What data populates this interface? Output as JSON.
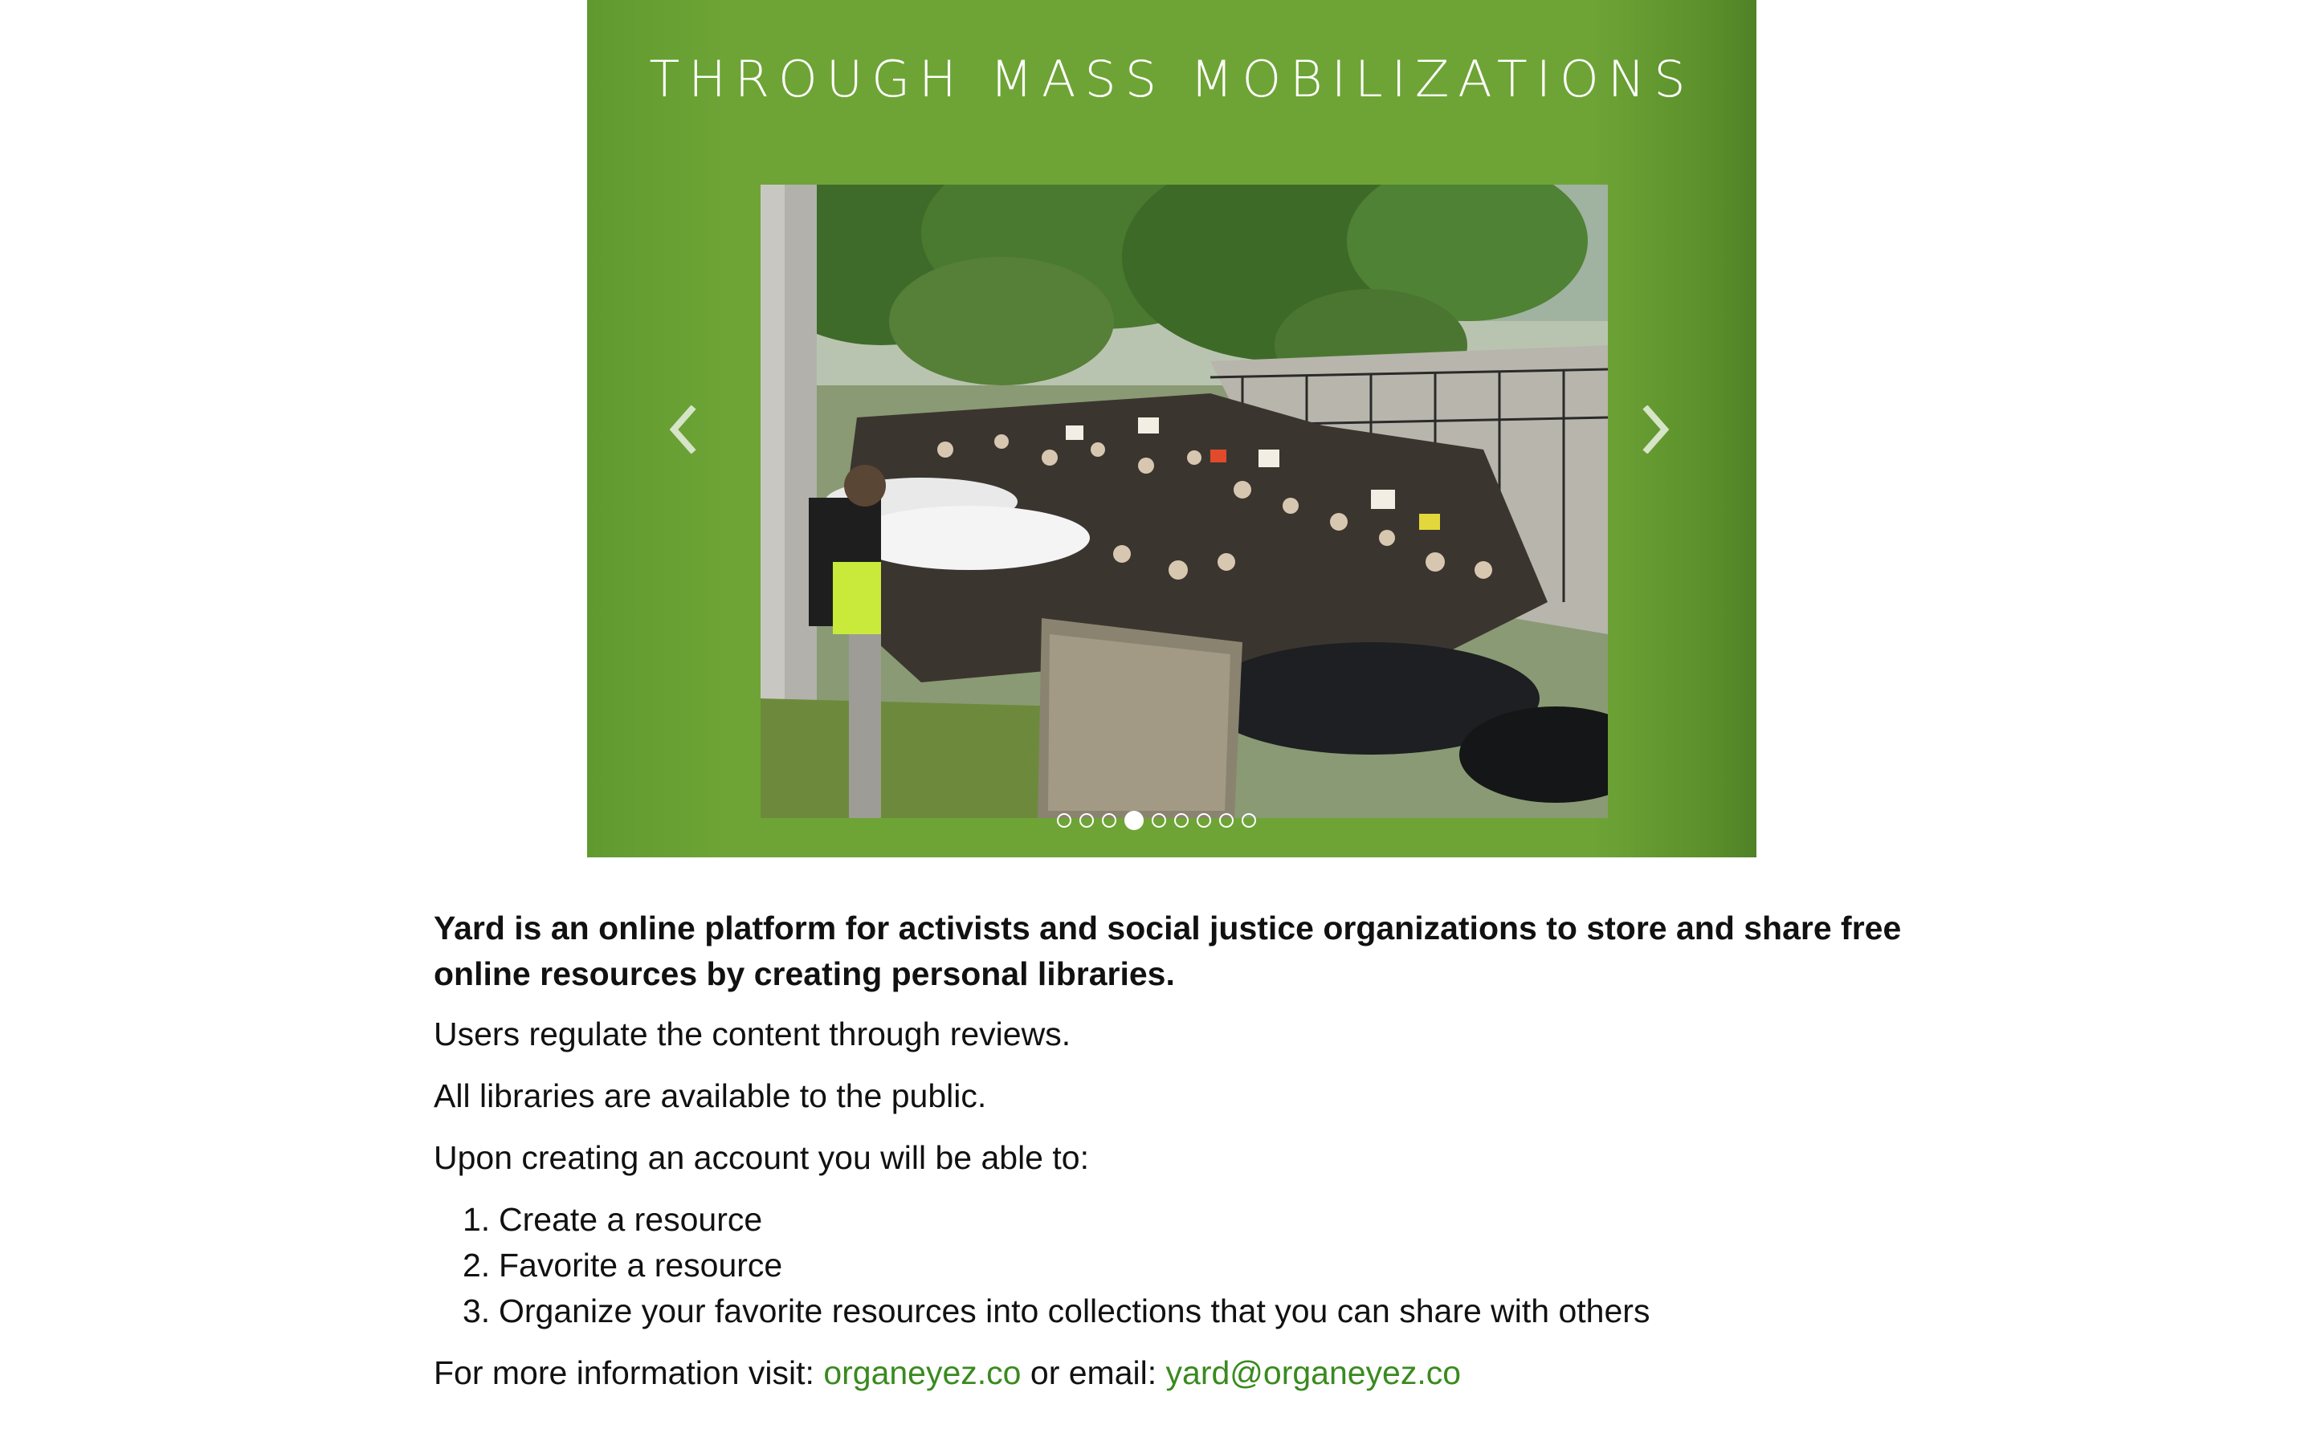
{
  "carousel": {
    "title": "THROUGH MASS MOBILIZATIONS",
    "slide_image": "crowd of protesters marching along a sidewalk beside parked cars and trees",
    "slide_count": 9,
    "active_slide": 4,
    "prev_icon": "chevron-left-icon",
    "next_icon": "chevron-right-icon",
    "background_color": "#6ea436"
  },
  "about": {
    "intro": "Yard is an online platform for activists and social justice organizations to store and share free online resources by creating personal libraries.",
    "line1": "Users regulate the content through reviews.",
    "line2": "All libraries are available to the public.",
    "line3": "Upon creating an account you will be able to:",
    "steps": [
      {
        "num": "1.",
        "text": "Create a resource"
      },
      {
        "num": "2.",
        "text": "Favorite a resource"
      },
      {
        "num": "3.",
        "text": "Organize your favorite resources into collections that you can share with others"
      }
    ],
    "contact_prefix": "For more information visit:",
    "site_link": "organeyez.co",
    "contact_middle": "or email:",
    "email_link": "yard@organeyez.co",
    "link_color": "#3a8a1f"
  }
}
